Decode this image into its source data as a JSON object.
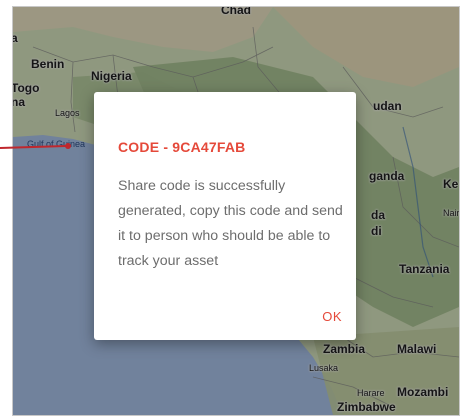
{
  "map": {
    "labels": {
      "chad": "Chad",
      "benin": "Benin",
      "nigeria": "Nigeria",
      "togo": "Togo",
      "lagos": "Lagos",
      "gulf": "Gulf of Guinea",
      "sudan": "udan",
      "uganda": "ganda",
      "kenya": "Ke",
      "nairobi": "Nairo",
      "tanzania": "Tanzania",
      "zambia": "Zambia",
      "malawi": "Malawi",
      "lusaka": "Lusaka",
      "harare": "Harare",
      "mozambique": "Mozambi",
      "zimbabwe": "Zimbabwe",
      "left_top": "a",
      "left_mid": "na",
      "rda": "da",
      "rdi": "di"
    }
  },
  "dialog": {
    "title": "CODE - 9CA47FAB",
    "message": "Share code is successfully generated, copy this code and send it to person who should be able to track your asset",
    "ok_label": "OK"
  },
  "colors": {
    "accent": "#e5493a",
    "pointer": "#c0272d",
    "ocean": "#9db4d8",
    "land": "#c7d3b0"
  }
}
